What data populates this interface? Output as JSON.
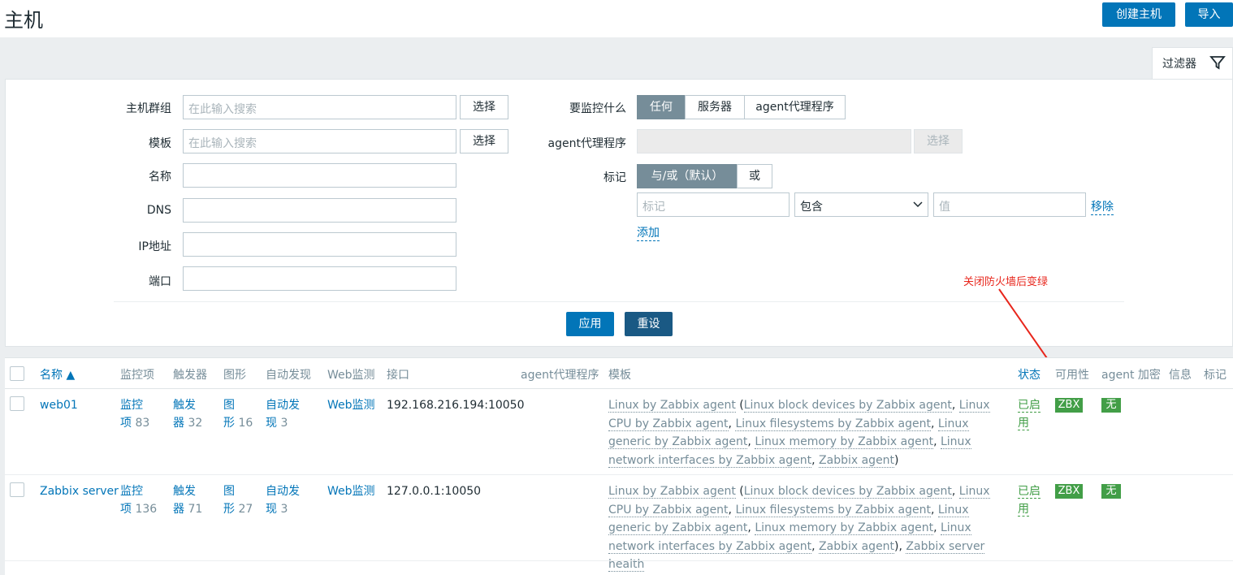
{
  "page": {
    "title": "主机",
    "create_button": "创建主机",
    "import_button": "导入"
  },
  "filter": {
    "tab_label": "过滤器",
    "host_group_label": "主机群组",
    "host_group_placeholder": "在此输入搜索",
    "template_label": "模板",
    "template_placeholder": "在此输入搜索",
    "select_label": "选择",
    "name_label": "名称",
    "dns_label": "DNS",
    "ip_label": "IP地址",
    "port_label": "端口",
    "monitor_what_label": "要监控什么",
    "monitor_what_options": [
      "任何",
      "服务器",
      "agent代理程序"
    ],
    "proxy_label": "agent代理程序",
    "tags_label": "标记",
    "tags_mode_options": [
      "与/或（默认）",
      "或"
    ],
    "tag_placeholder": "标记",
    "operator_value": "包含",
    "value_placeholder": "值",
    "remove_label": "移除",
    "add_label": "添加",
    "apply_label": "应用",
    "reset_label": "重设"
  },
  "annotation": "关闭防火墙后变绿",
  "table": {
    "columns": [
      "名称 ▲",
      "监控项",
      "触发器",
      "图形",
      "自动发现",
      "Web监测",
      "接口",
      "agent代理程序",
      "模板",
      "状态",
      "可用性",
      "agent 加密",
      "信息",
      "标记"
    ],
    "rows": [
      {
        "name": "web01",
        "items_a": "监控",
        "items_b": "项",
        "items_count": "83",
        "triggers_a": "触发",
        "triggers_b": "器",
        "triggers_count": "32",
        "graphs_a": "图",
        "graphs_b": "形",
        "graphs_count": "16",
        "discovery_a": "自动发",
        "discovery_b": "现",
        "discovery_count": "3",
        "web": "Web监测",
        "interface": "192.168.216.194:10050",
        "templates": [
          "Linux by Zabbix agent",
          " (",
          "Linux block devices by Zabbix agent",
          ", ",
          "Linux CPU by Zabbix agent",
          ", ",
          "Linux filesystems by Zabbix agent",
          ", ",
          "Linux generic by Zabbix agent",
          ", ",
          "Linux memory by Zabbix agent",
          ", ",
          "Linux network interfaces by Zabbix agent",
          ", ",
          "Zabbix agent",
          ")"
        ],
        "status_a": "已启",
        "status_b": "用",
        "availability": "ZBX",
        "encryption": "无"
      },
      {
        "name": "Zabbix server",
        "items_a": "监控",
        "items_b": "项",
        "items_count": "136",
        "triggers_a": "触发",
        "triggers_b": "器",
        "triggers_count": "71",
        "graphs_a": "图",
        "graphs_b": "形",
        "graphs_count": "27",
        "discovery_a": "自动发",
        "discovery_b": "现",
        "discovery_count": "3",
        "web": "Web监测",
        "interface": "127.0.0.1:10050",
        "templates": [
          "Linux by Zabbix agent",
          " (",
          "Linux block devices by Zabbix agent",
          ", ",
          "Linux CPU by Zabbix agent",
          ", ",
          "Linux filesystems by Zabbix agent",
          ", ",
          "Linux generic by Zabbix agent",
          ", ",
          "Linux memory by Zabbix agent",
          ", ",
          "Linux network interfaces by Zabbix agent",
          ", ",
          "Zabbix agent",
          "), ",
          "Zabbix server health"
        ],
        "status_a": "已启",
        "status_b": "用",
        "availability": "ZBX",
        "encryption": "无"
      }
    ]
  },
  "colors": {
    "primary": "#0275b8",
    "status_green": "#429e47",
    "annotation_red": "#e8261c"
  }
}
